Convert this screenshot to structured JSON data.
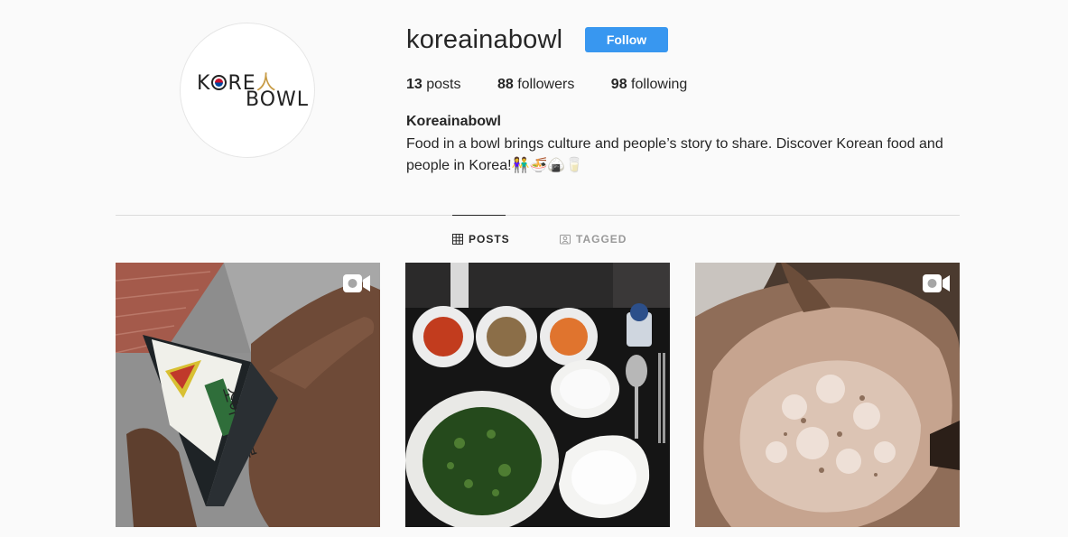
{
  "profile": {
    "username": "koreainabowl",
    "follow_label": "Follow",
    "full_name": "Koreainabowl",
    "bio": "Food in a bowl brings culture and people’s story to share. Discover Korean food and people in Korea!👫🍜🍙🥛",
    "logo": {
      "line1_a": "K",
      "line1_b": "RE",
      "line1_c": "人",
      "line2": "BOWL"
    }
  },
  "stats": {
    "posts_count": "13",
    "posts_label": "posts",
    "followers_count": "88",
    "followers_label": "followers",
    "following_count": "98",
    "following_label": "following"
  },
  "tabs": {
    "posts_label": "POSTS",
    "tagged_label": "TAGGED",
    "active": "posts"
  },
  "posts": [
    {
      "type": "video",
      "subject": "kimbap-triangle",
      "icon": "video-camera-icon"
    },
    {
      "type": "image",
      "subject": "korean-meal-tray"
    },
    {
      "type": "video",
      "subject": "bingsu-shaved-ice",
      "icon": "video-camera-icon"
    }
  ],
  "colors": {
    "accent": "#3897f0",
    "background": "#fafafa",
    "text": "#262626",
    "muted": "#999999",
    "divider": "#dbdbdb"
  }
}
